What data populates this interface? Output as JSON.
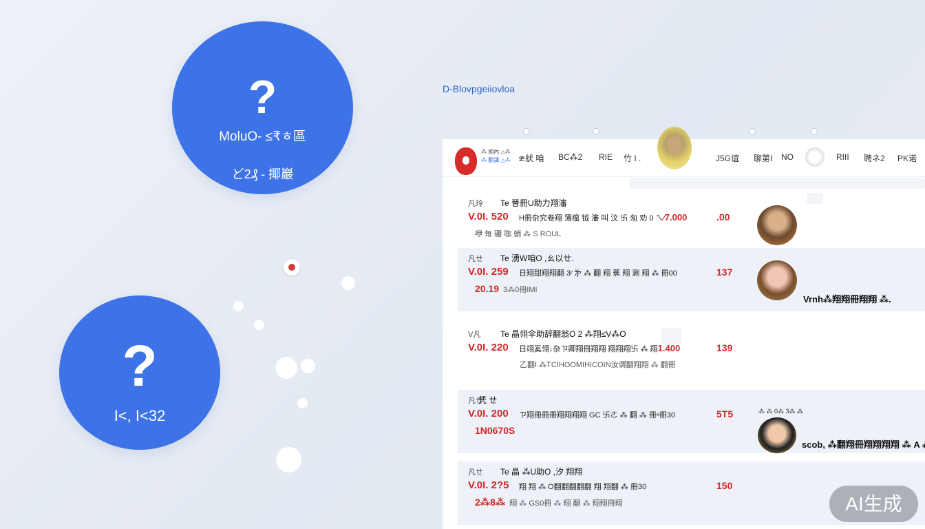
{
  "bubbles": [
    {
      "mark": "?",
      "line1": "MoluO- ≤₹ㅎ區",
      "line2": "ど2₰ - 揶巖"
    },
    {
      "mark": "?",
      "line1": "I<, I<32"
    }
  ],
  "panel": {
    "heading": "D-Blovpgeiiovloa",
    "brand": {
      "line1": "⁂ 國內 △⁂",
      "line2": "⁂ 翻譯 △⁂"
    },
    "tabs": [
      "≇狀 咱",
      "BC⁂2",
      "RIE",
      "竹 I .",
      "J5G谊",
      "聊第I",
      "NO",
      "RIII",
      "聘ネ2",
      "PK诺"
    ],
    "rows": [
      {
        "meta": "凡玲",
        "title": "Te  晉冊U助力翔瀋",
        "code": "V.0I. 520",
        "desc": "H冊杂究卷翔 簿瘤 钺 瀋 叫 汶 卐 匆 劝 0 ㄟ",
        "desc_hl": "⁄7.000",
        "score": ".00",
        "sub": "咿 毎 硼 咖 蛸 ⁂ S ROUL"
      },
      {
        "meta": "凡ㄝ",
        "title": "Te  湧W咱O ,ㄠ以ㄝ.",
        "code": "V.0I. 259",
        "desc": "日翔甜翔翔翻 3⁄ 㐧 ⁂ 翻 翔 蕉 翔 涮 翔 ⁂ 冊00",
        "score": "137",
        "sub_amount": "20.19",
        "sub": "3⁂0冊IMI"
      },
      {
        "meta": "V凡",
        "title": "Te  晶翎伞助辞翻翁O 2 ⁂翔≤V⁂O",
        "code": "V.0I. 220",
        "desc": "日翊奚翎↓杂ㄗ卿翔冊翔翔 翔翔翔卐 ⁂ 翔",
        "desc_hl": "1.400",
        "score": "139",
        "sub": "乙翻I.⁂TCIHOOMIHICOIN汝谓翻翔翔 ⁂ 翻冊"
      },
      {
        "meta": "凡ㄝ",
        "title": "凭 ㄝ",
        "code": "V.0I. 200",
        "desc": "ㄗ翔冊冊冊翔翔翔翔 GC 卐ㄜ ⁂ 翻 ⁂ 冊",
        "desc_hl": "ᵃ冊30",
        "score": "5T5",
        "sub_amount": "1N0670S",
        "sub": ""
      },
      {
        "meta": "凡ㄝ",
        "title": "Te  晶 ⁂U助O ,汐 翔翔",
        "code": "V.0I. 2?5",
        "desc": "翔 翔 ⁂ O翻翻翻翻翻 翔 翔翻 ⁂ 冊30",
        "score": "150",
        "sub_amount": "2⁂8⁂",
        "sub": "翔 ⁂ GS0冊 ⁂ 翔 翻 ⁂ 翔翔冊翔"
      }
    ],
    "side_labels": [
      "Vrnh⁂翔翔冊翔翔 ⁂.",
      "scob, ⁂翻翔冊翔翔翔翔 ⁂ A ⁂ ."
    ],
    "side_meta": "⁂ ⁂ 0⁂ 3⁂ ⁂"
  },
  "watermark": "AI生成"
}
